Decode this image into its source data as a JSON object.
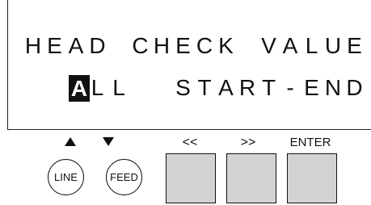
{
  "display": {
    "line1_text": "HEAD CHECK VALUE",
    "line2": {
      "cursor_char": "A",
      "rest_of_option1": "LL",
      "option2": "START-END"
    }
  },
  "keys": {
    "line": {
      "label": "LINE",
      "indicator": "triangle-up-icon"
    },
    "feed": {
      "label": "FEED",
      "indicator": "triangle-down-icon"
    },
    "prev": {
      "label": "<<"
    },
    "next": {
      "label": ">>"
    },
    "enter": {
      "label": "ENTER"
    }
  },
  "colors": {
    "foreground": "#111111",
    "key_fill": "#d3d3d3",
    "background": "#ffffff"
  }
}
